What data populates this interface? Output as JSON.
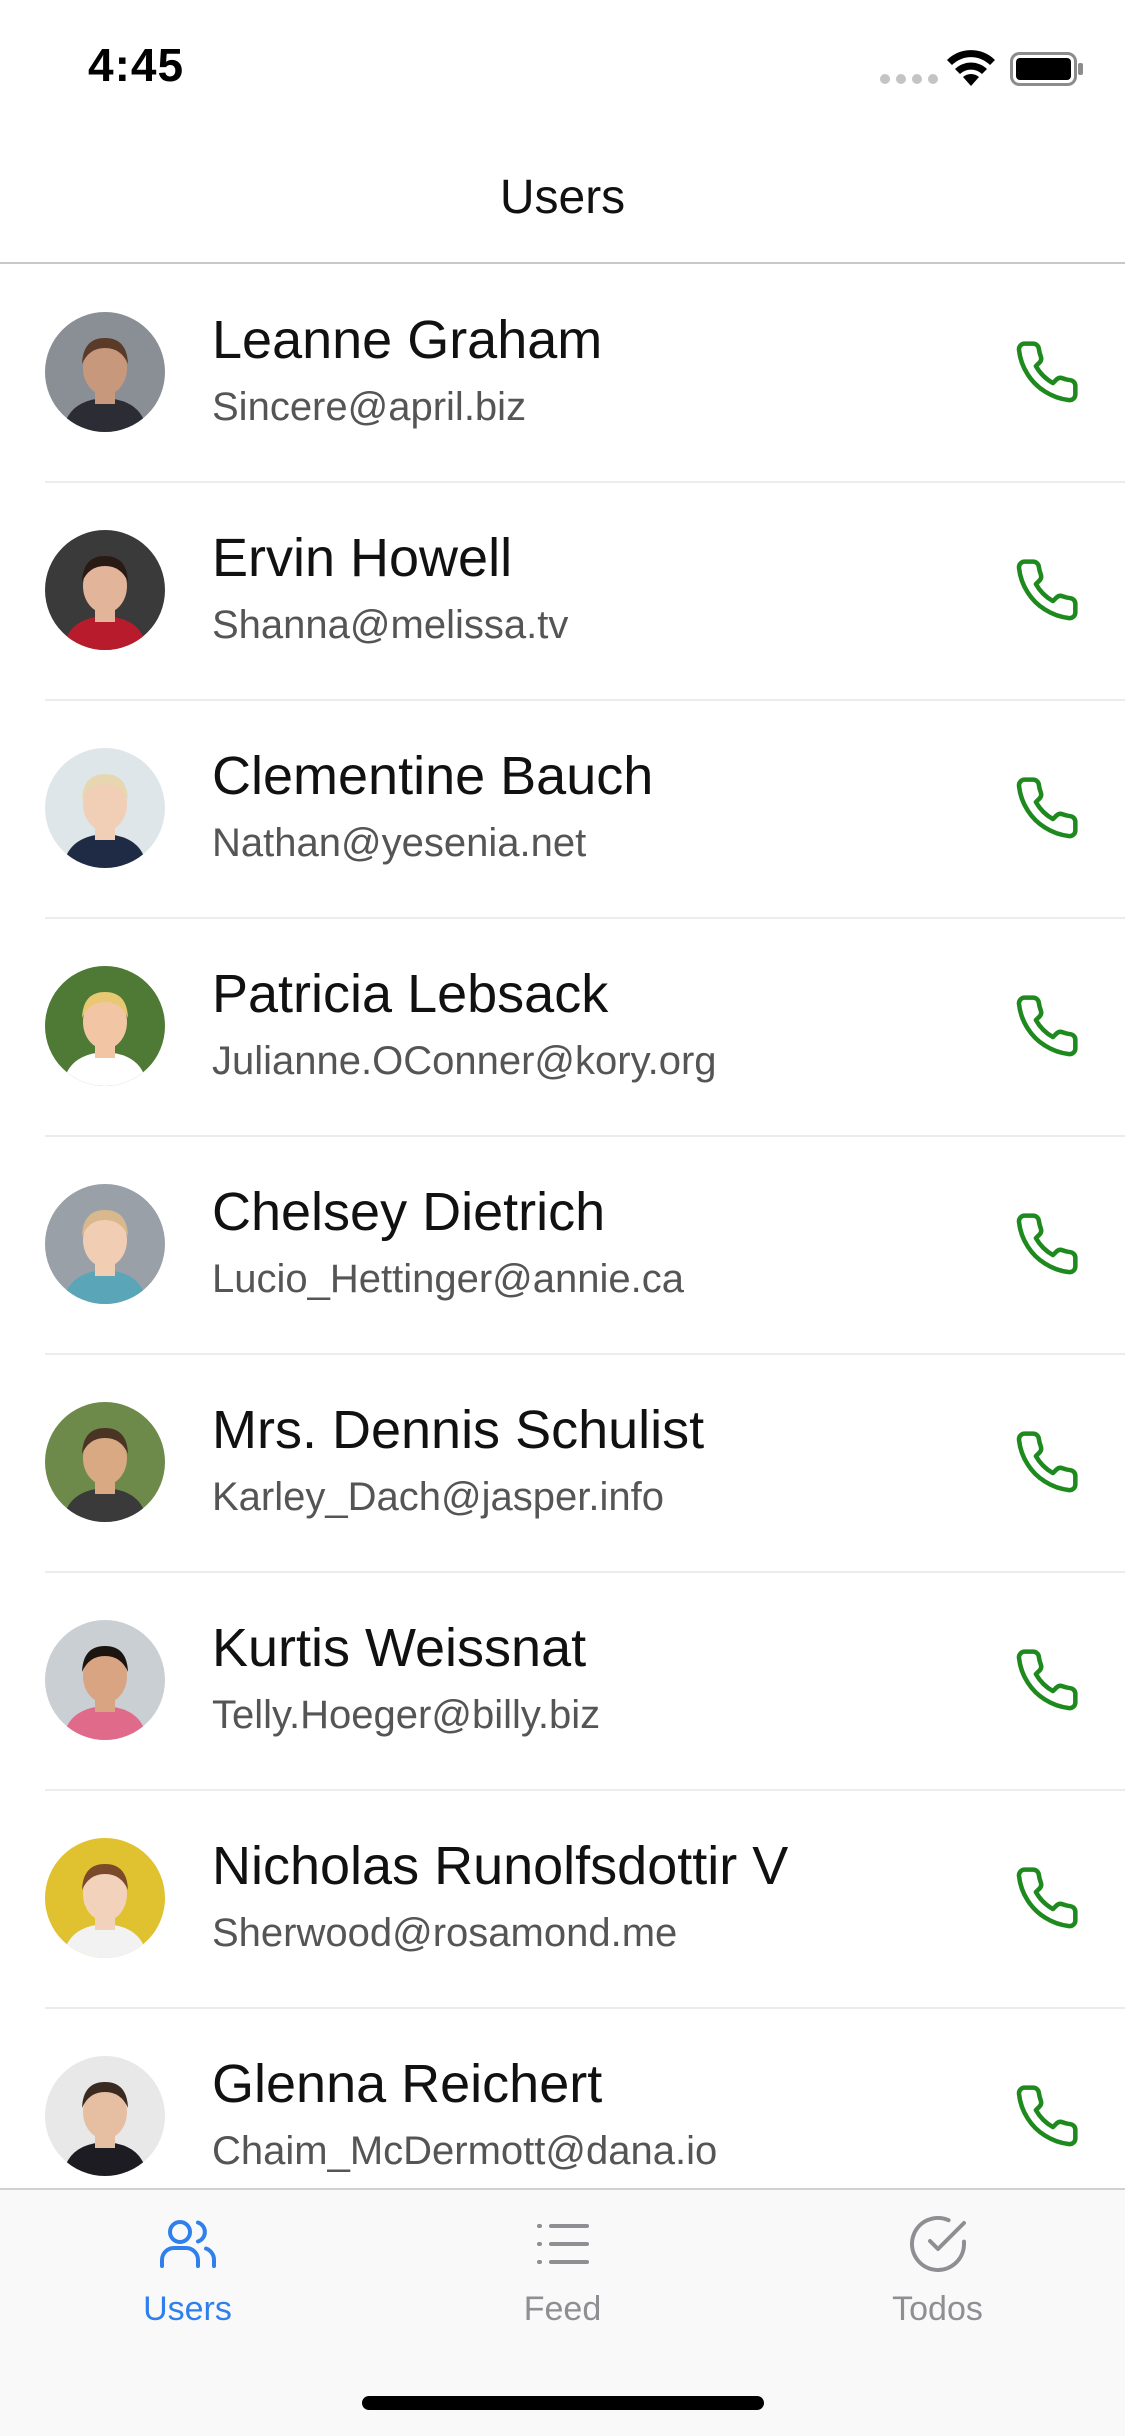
{
  "status_bar": {
    "time": "4:45"
  },
  "nav": {
    "title": "Users"
  },
  "colors": {
    "accent": "#2f80ed",
    "call": "#1e8a1e",
    "inactive": "#8e8e93"
  },
  "users": [
    {
      "name": "Leanne Graham",
      "email": "Sincere@april.biz",
      "avatar": {
        "bg": "#8a8f96",
        "skin": "#c8987c",
        "hair": "#5a3a28",
        "shirt": "#2c2c34"
      }
    },
    {
      "name": "Ervin Howell",
      "email": "Shanna@melissa.tv",
      "avatar": {
        "bg": "#3a3a3a",
        "skin": "#e2b49a",
        "hair": "#2a1a14",
        "shirt": "#b81c2c"
      }
    },
    {
      "name": "Clementine Bauch",
      "email": "Nathan@yesenia.net",
      "avatar": {
        "bg": "#dfe6ea",
        "skin": "#f0cfb6",
        "hair": "#e6d7b0",
        "shirt": "#1f2a44"
      }
    },
    {
      "name": "Patricia Lebsack",
      "email": "Julianne.OConner@kory.org",
      "avatar": {
        "bg": "#4e7a36",
        "skin": "#f2c6a4",
        "hair": "#e9c873",
        "shirt": "#ffffff"
      }
    },
    {
      "name": "Chelsey Dietrich",
      "email": "Lucio_Hettinger@annie.ca",
      "avatar": {
        "bg": "#9aa0a8",
        "skin": "#f1cdb3",
        "hair": "#d8b88c",
        "shirt": "#5aa6b8"
      }
    },
    {
      "name": "Mrs. Dennis Schulist",
      "email": "Karley_Dach@jasper.info",
      "avatar": {
        "bg": "#6e8a4a",
        "skin": "#d9a984",
        "hair": "#4a3424",
        "shirt": "#3a3a3a"
      }
    },
    {
      "name": "Kurtis Weissnat",
      "email": "Telly.Hoeger@billy.biz",
      "avatar": {
        "bg": "#c9cfd3",
        "skin": "#d9a482",
        "hair": "#1c1410",
        "shirt": "#e06a8a"
      }
    },
    {
      "name": "Nicholas Runolfsdottir V",
      "email": "Sherwood@rosamond.me",
      "avatar": {
        "bg": "#e0c230",
        "skin": "#f3d2bb",
        "hair": "#7a4a2a",
        "shirt": "#f2f2f2"
      }
    },
    {
      "name": "Glenna Reichert",
      "email": "Chaim_McDermott@dana.io",
      "avatar": {
        "bg": "#e8e8e8",
        "skin": "#e6bfa2",
        "hair": "#3a2a20",
        "shirt": "#1c1c22"
      }
    }
  ],
  "tabs": [
    {
      "label": "Users",
      "icon": "users-icon",
      "active": true
    },
    {
      "label": "Feed",
      "icon": "list-icon",
      "active": false
    },
    {
      "label": "Todos",
      "icon": "check-circle-icon",
      "active": false
    }
  ]
}
